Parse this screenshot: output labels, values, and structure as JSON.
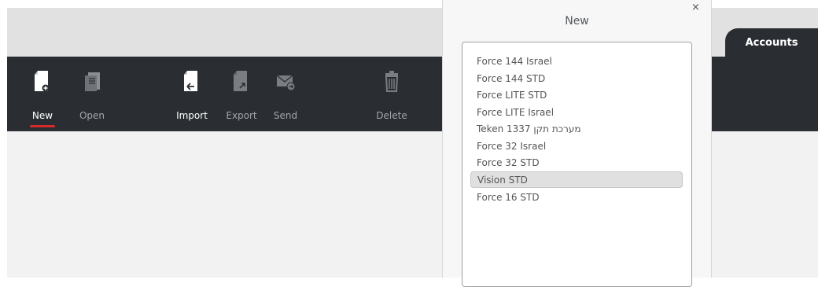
{
  "tabs": {
    "accounts": "Accounts"
  },
  "toolbar": {
    "new": "New",
    "open": "Open",
    "import": "Import",
    "export": "Export",
    "send": "Send",
    "delete": "Delete"
  },
  "dialog": {
    "title": "New",
    "close": "×",
    "items": [
      "Force 144 Israel",
      "Force 144 STD",
      "Force LITE STD",
      "Force LITE Israel",
      "Teken 1337 מערכת תקן",
      "Force 32 Israel",
      "Force 32 STD",
      "Vision STD",
      "Force 16 STD"
    ],
    "selected_item": "Vision STD"
  },
  "colors": {
    "toolbar_bg": "#2a2e33",
    "accent_underline": "#d52b2b"
  },
  "icons": {
    "new": "new-document-icon",
    "open": "open-document-icon",
    "import": "import-icon",
    "export": "export-icon",
    "send": "send-mail-icon",
    "delete": "trash-icon"
  }
}
